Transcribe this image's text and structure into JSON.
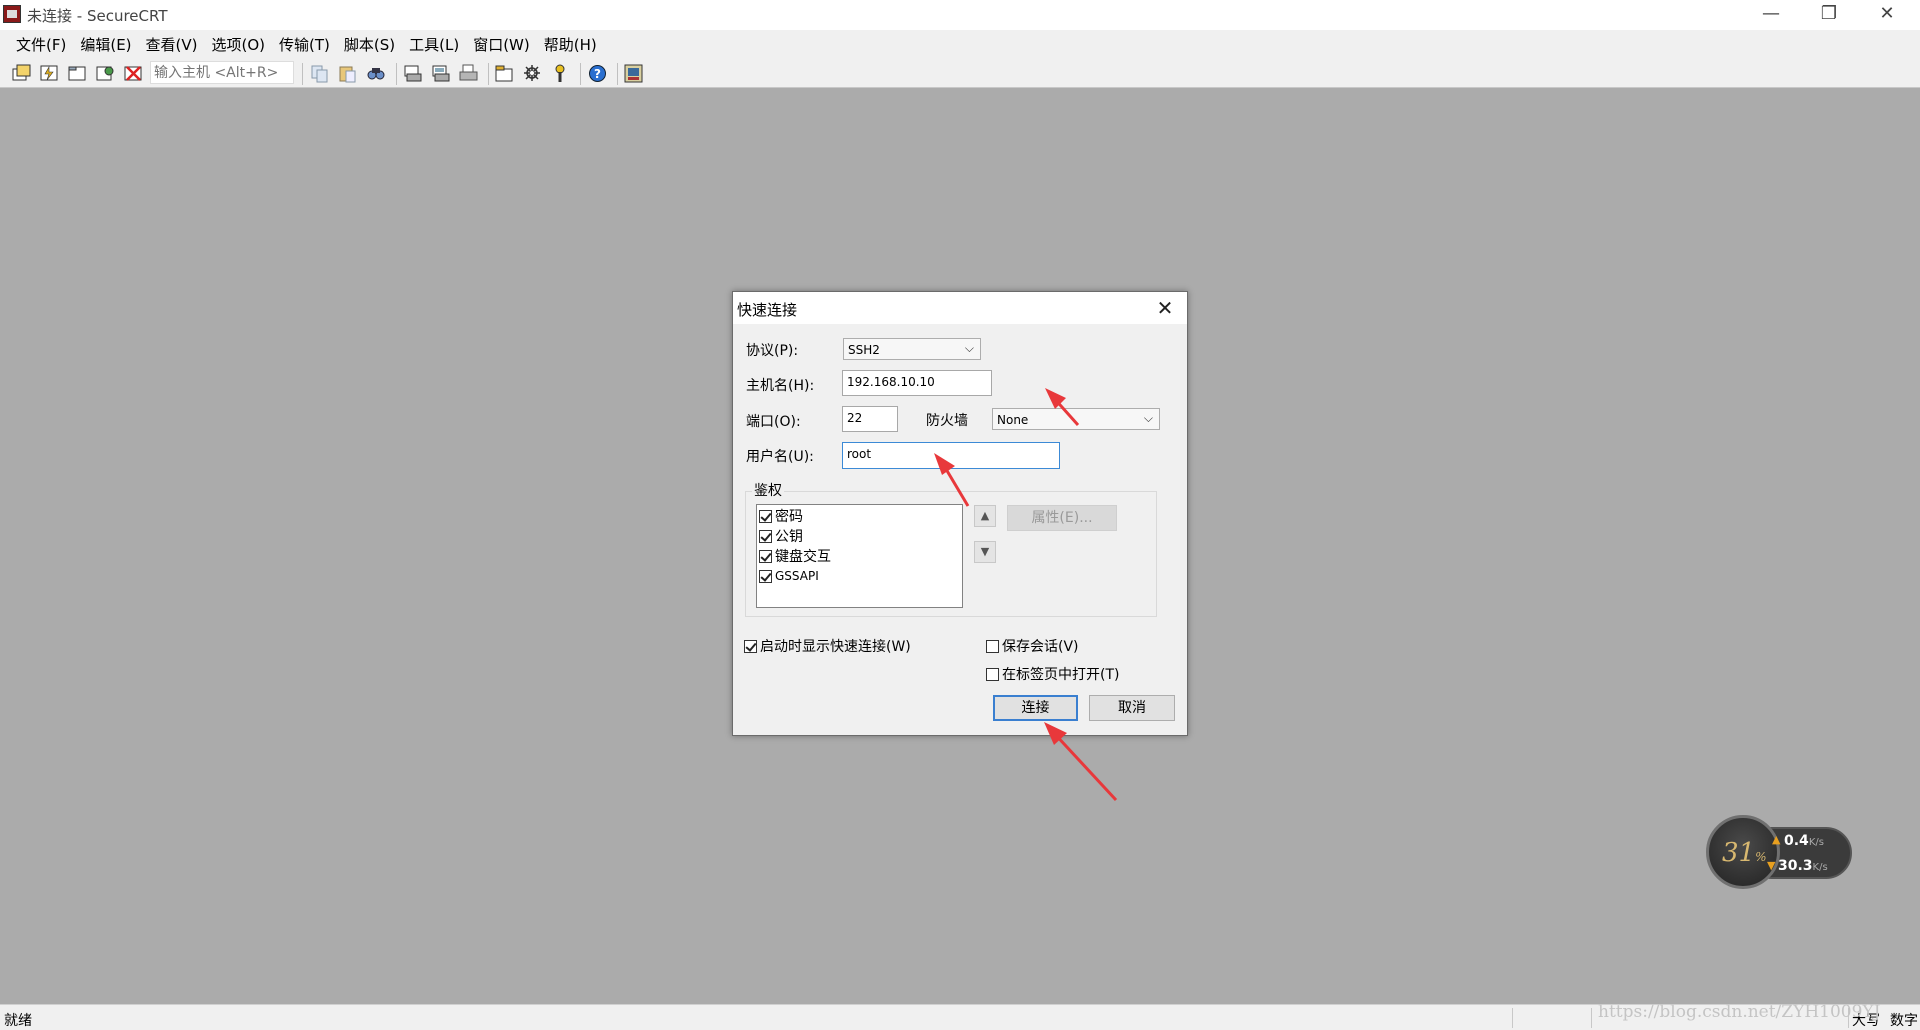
{
  "window": {
    "title": "未连接 - SecureCRT",
    "minimize": "—",
    "maximize": "❐",
    "close": "✕"
  },
  "menu": [
    "文件(F)",
    "编辑(E)",
    "查看(V)",
    "选项(O)",
    "传输(T)",
    "脚本(S)",
    "工具(L)",
    "窗口(W)",
    "帮助(H)"
  ],
  "toolbar": {
    "host_placeholder": "输入主机 <Alt+R>",
    "icons": [
      "connect-icon",
      "quick-connect-icon",
      "connect-in-tab-icon",
      "reconnect-icon",
      "disconnect-icon",
      "copy-icon",
      "paste-icon",
      "find-icon",
      "print-screen-icon",
      "print-selection-icon",
      "print-icon",
      "session-options-icon",
      "global-options-icon",
      "keymap-icon",
      "help-icon",
      "about-icon"
    ]
  },
  "dialog": {
    "title": "快速连接",
    "protocol_label": "协议(P):",
    "protocol_value": "SSH2",
    "hostname_label": "主机名(H):",
    "hostname_value": "192.168.10.10",
    "port_label": "端口(O):",
    "port_value": "22",
    "firewall_label": "防火墙",
    "firewall_value": "None",
    "username_label": "用户名(U):",
    "username_value": "root",
    "auth_group_label": "鉴权",
    "auth_methods": [
      {
        "label": "密码",
        "checked": true
      },
      {
        "label": "公钥",
        "checked": true
      },
      {
        "label": "键盘交互",
        "checked": true
      },
      {
        "label": "GSSAPI",
        "checked": true
      }
    ],
    "properties_button": "属性(E)...",
    "show_on_startup_label": "启动时显示快速连接(W)",
    "show_on_startup_checked": true,
    "save_session_label": "保存会话(V)",
    "save_session_checked": false,
    "open_in_tab_label": "在标签页中打开(T)",
    "open_in_tab_checked": false,
    "connect_button": "连接",
    "cancel_button": "取消"
  },
  "status": {
    "text": "就绪",
    "caps": "大写",
    "num": "数字",
    "watermark": "https://blog.csdn.net/ZYH1009YJ"
  },
  "network_widget": {
    "percent": "31",
    "percent_sign": "%",
    "upload": "0.4",
    "download": "30.3",
    "unit": "K/s"
  },
  "colors": {
    "workspace": "#ababab",
    "annotation_arrow": "#e8383b",
    "focus_border": "#3c8ad6"
  }
}
